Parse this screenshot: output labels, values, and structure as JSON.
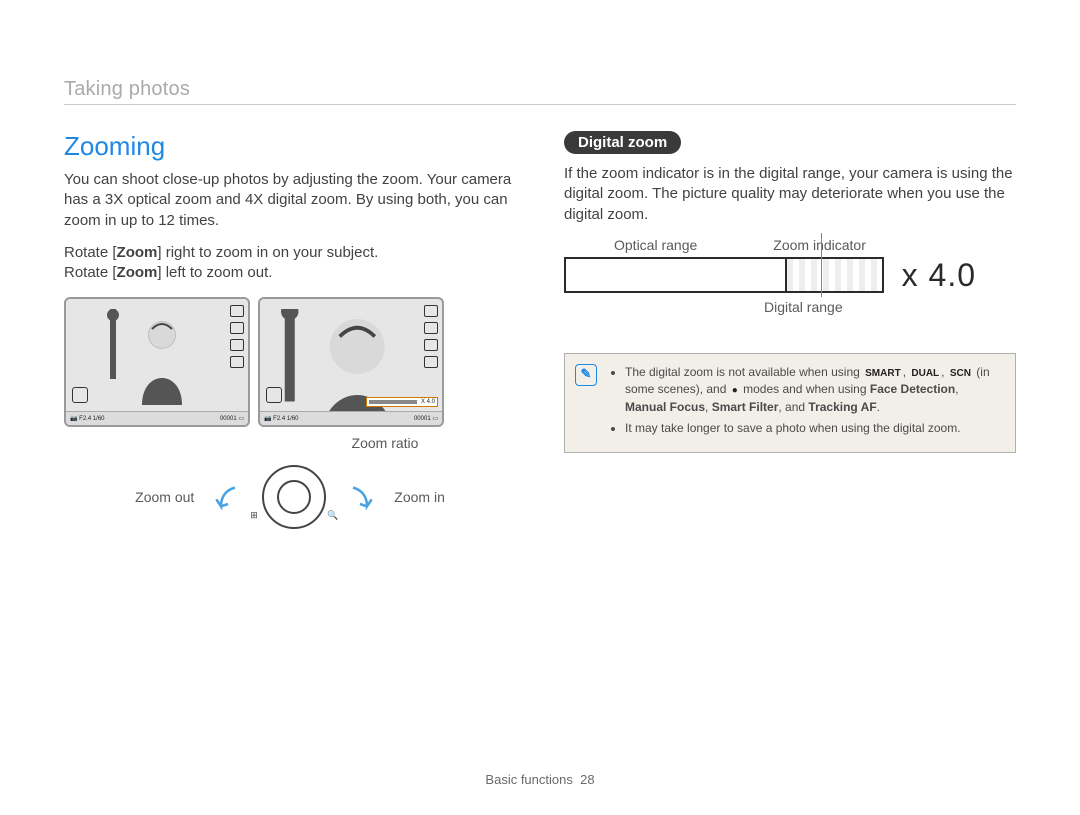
{
  "breadcrumb": "Taking photos",
  "col_left": {
    "heading": "Zooming",
    "intro": "You can shoot close-up photos by adjusting the zoom. Your camera has a 3X optical zoom and 4X digital zoom. By using both, you can zoom in up to 12 times.",
    "rotate_in_pre": "Rotate [",
    "rotate_in_bold": "Zoom",
    "rotate_in_post": "] right to zoom in on your subject.",
    "rotate_out_pre": "Rotate [",
    "rotate_out_bold": "Zoom",
    "rotate_out_post": "] left to zoom out.",
    "zoom_ratio_label": "Zoom ratio",
    "zoom_out_label": "Zoom out",
    "zoom_in_label": "Zoom in",
    "screen1_bottom": {
      "left": "F2.4  1/60",
      "right": "00001"
    },
    "screen2_bottom": {
      "left": "F2.4  1/60",
      "right": "00001",
      "zoom_text": "X 4.0"
    }
  },
  "col_right": {
    "pill": "Digital zoom",
    "p1": "If the zoom indicator is in the digital range, your camera is using the digital zoom. The picture quality may deteriorate when you use the digital zoom.",
    "optical_label": "Optical range",
    "indicator_label": "Zoom indicator",
    "digital_label": "Digital range",
    "zoom_value": "4.0",
    "note": {
      "li1_pre": "The digital zoom is not available when using ",
      "li1_icon1": "SMART",
      "li1_icon2": "DUAL",
      "li1_mid": ", ",
      "li1_scn": "SCN",
      "li1_mid2": " (in some scenes), and ",
      "li1_icon3": "●",
      "li1_mid3": " modes and when using ",
      "li1_bold1": "Face Detection",
      "li1_sep1": ", ",
      "li1_bold2": "Manual Focus",
      "li1_sep2": ", ",
      "li1_bold3": "Smart Filter",
      "li1_sep3": ", and ",
      "li1_bold4": "Tracking AF",
      "li1_end": ".",
      "li2": "It may take longer to save a photo when using the digital zoom."
    }
  },
  "footer": {
    "section": "Basic functions",
    "page": "28"
  }
}
